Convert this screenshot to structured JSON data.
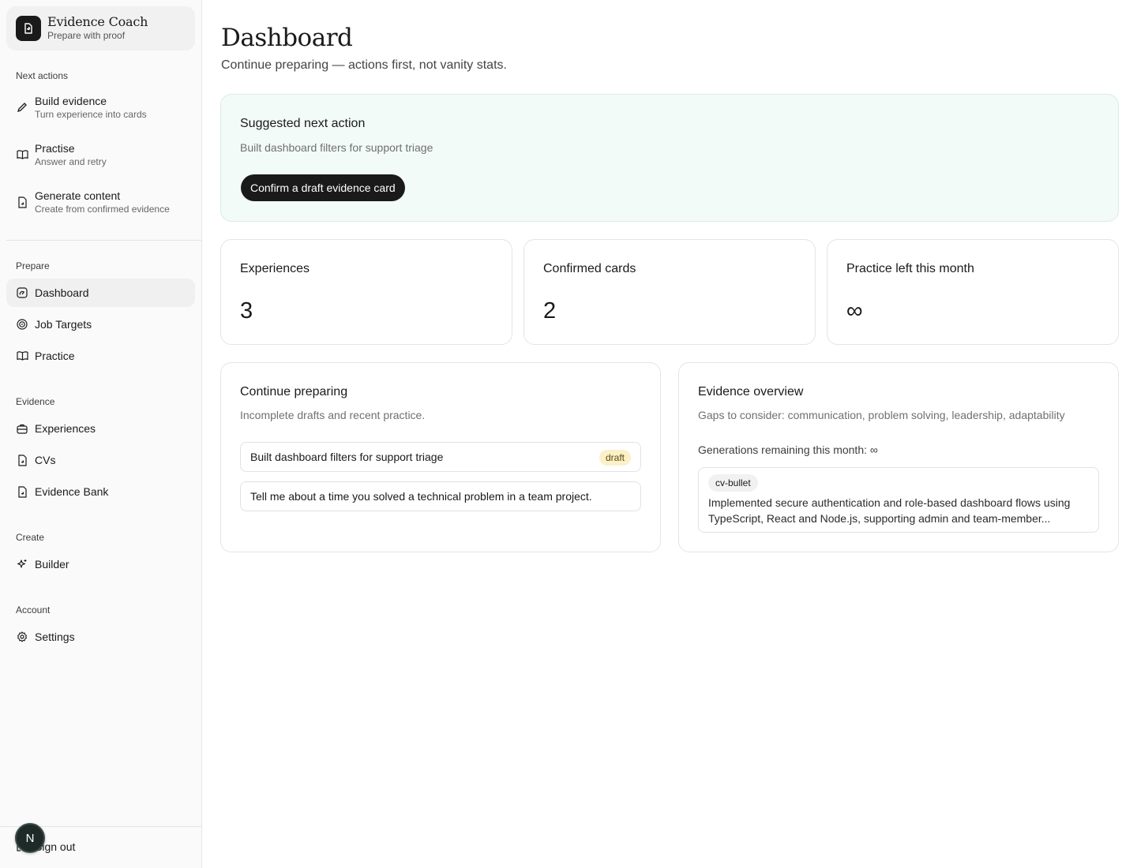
{
  "brand": {
    "title": "Evidence Coach",
    "subtitle": "Prepare with proof",
    "icon": "document-icon"
  },
  "sidebar": {
    "next_actions_label": "Next actions",
    "next_actions": [
      {
        "label": "Build evidence",
        "sub": "Turn experience into cards",
        "icon": "pencil-icon"
      },
      {
        "label": "Practise",
        "sub": "Answer and retry",
        "icon": "book-open-icon"
      },
      {
        "label": "Generate content",
        "sub": "Create from confirmed evidence",
        "icon": "document-icon"
      }
    ],
    "prepare_label": "Prepare",
    "prepare": [
      {
        "label": "Dashboard",
        "icon": "gauge-icon",
        "active": true
      },
      {
        "label": "Job Targets",
        "icon": "target-icon"
      },
      {
        "label": "Practice",
        "icon": "book-open-icon"
      }
    ],
    "evidence_label": "Evidence",
    "evidence": [
      {
        "label": "Experiences",
        "icon": "briefcase-icon"
      },
      {
        "label": "CVs",
        "icon": "document-icon"
      },
      {
        "label": "Evidence Bank",
        "icon": "document-icon"
      }
    ],
    "create_label": "Create",
    "create": [
      {
        "label": "Builder",
        "icon": "sparkles-icon"
      }
    ],
    "account_label": "Account",
    "account": [
      {
        "label": "Settings",
        "icon": "gear-icon"
      }
    ],
    "signout_label": "Sign out",
    "avatar_initial": "N"
  },
  "main": {
    "title": "Dashboard",
    "subtitle": "Continue preparing — actions first, not vanity stats.",
    "suggested": {
      "title": "Suggested next action",
      "subtitle": "Built dashboard filters for support triage",
      "button": "Confirm a draft evidence card"
    },
    "stats": [
      {
        "label": "Experiences",
        "value": "3"
      },
      {
        "label": "Confirmed cards",
        "value": "2"
      },
      {
        "label": "Practice left this month",
        "value": "∞"
      }
    ],
    "continue": {
      "title": "Continue preparing",
      "subtitle": "Incomplete drafts and recent practice.",
      "items": [
        {
          "text": "Built dashboard filters for support triage",
          "badge": "draft"
        },
        {
          "text": "Tell me about a time you solved a technical problem in a team project."
        }
      ]
    },
    "overview": {
      "title": "Evidence overview",
      "gaps": "Gaps to consider: communication, problem solving, leadership, adaptability",
      "generations": "Generations remaining this month: ∞",
      "bullet_tag": "cv-bullet",
      "bullet_text": "Implemented secure authentication and role-based dashboard flows using TypeScript, React and Node.js, supporting admin and team-member..."
    }
  },
  "colors": {
    "accent_dark": "#1a1a1a",
    "suggest_bg": "#f2fbf7",
    "draft_badge": "#fbf0c8"
  }
}
